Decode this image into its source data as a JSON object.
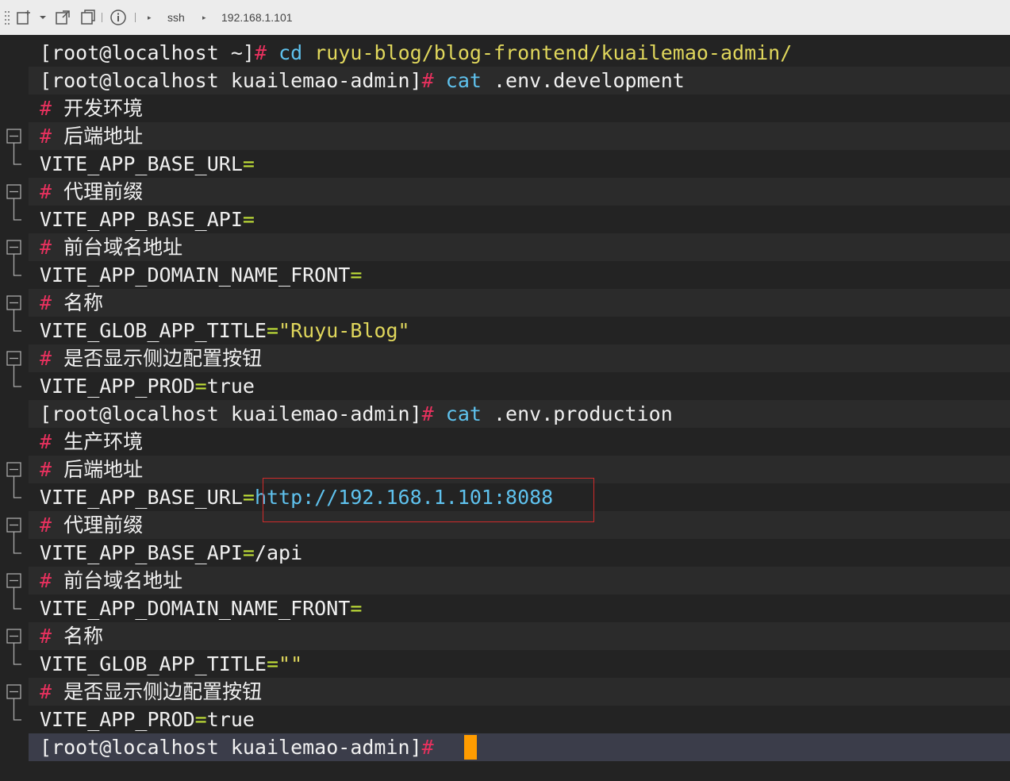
{
  "toolbar": {
    "breadcrumb": [
      "ssh",
      "192.168.1.101"
    ],
    "icons": [
      "drag-handle-icon",
      "new-tab-icon",
      "chevron-down-icon",
      "detach-icon",
      "clone-icon",
      "info-icon"
    ]
  },
  "terminal": {
    "prompt_home": "[root@localhost ~]",
    "prompt_dir": "[root@localhost kuailemao-admin]",
    "hash": "#",
    "cmd1": "cd",
    "cmd1_arg": "ruyu-blog/blog-frontend/kuailemao-admin/",
    "cmd_cat": "cat",
    "file_dev": ".env.development",
    "file_prod": ".env.production",
    "comments": {
      "dev_env": "开发环境",
      "prod_env": "生产环境",
      "backend": "后端地址",
      "proxy": "代理前缀",
      "front_domain": "前台域名地址",
      "name": "名称",
      "sidebar": "是否显示侧边配置按钮"
    },
    "keys": {
      "base_url": "VITE_APP_BASE_URL",
      "base_api": "VITE_APP_BASE_API",
      "domain": "VITE_APP_DOMAIN_NAME_FRONT",
      "title": "VITE_GLOB_APP_TITLE",
      "prod": "VITE_APP_PROD"
    },
    "eq": "=",
    "dev_values": {
      "title": "\"Ruyu-Blog\"",
      "prod": "true"
    },
    "prod_values": {
      "base_url": "http://192.168.1.101:8088",
      "base_api": "/api",
      "title": "\"\"",
      "prod": "true"
    }
  },
  "colors": {
    "background": "#232323",
    "hash": "#e8315e",
    "command": "#5fc2ee",
    "path": "#e0d75c",
    "equals": "#c1e038",
    "cursor": "#ff9c00",
    "highlight_box": "#d12b2b"
  }
}
